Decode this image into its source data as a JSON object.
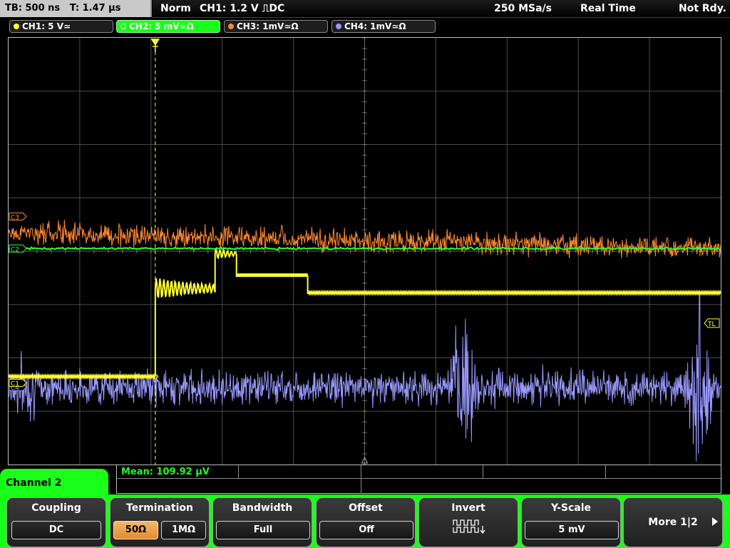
{
  "top": {
    "timebase": "TB: 500 ns",
    "trigger_time": "T: 1.47 µs",
    "mode": "Norm",
    "trigger_info": "CH1: 1.2 V ⎍DC",
    "sample_rate": "250 MSa/s",
    "acq_mode": "Real Time",
    "status": "Not Rdy."
  },
  "channels": [
    {
      "label": "CH1: 5 V≃",
      "color": "#ffff33",
      "active": false
    },
    {
      "label": "CH2: 5 mV≃Ω",
      "color": "#33ff33",
      "active": true
    },
    {
      "label": "CH3: 1mV≃Ω",
      "color": "#ff8833",
      "active": false
    },
    {
      "label": "CH4: 1mV≃Ω",
      "color": "#9999ff",
      "active": false
    }
  ],
  "markers": {
    "ch3": "C3",
    "ch2": "C2",
    "ch1": "C1",
    "ch4": "C4",
    "trigger_level": "TL"
  },
  "measurement": {
    "text": "Mean: 109.92 µV"
  },
  "menu": {
    "title": "Channel 2",
    "coupling": {
      "label": "Coupling",
      "value": "DC"
    },
    "termination": {
      "label": "Termination",
      "opt1": "50Ω",
      "opt2": "1MΩ",
      "selected": "50Ω"
    },
    "bandwidth": {
      "label": "Bandwidth",
      "value": "Full"
    },
    "offset": {
      "label": "Offset",
      "value": "Off"
    },
    "invert": {
      "label": "Invert",
      "icon": "invert-waveform-icon"
    },
    "yscale": {
      "label": "Y-Scale",
      "value": "5 mV"
    },
    "more": {
      "label": "More 1|2"
    }
  },
  "colors": {
    "ch1": "#ffff33",
    "ch2": "#33ff33",
    "ch3": "#ff8833",
    "ch4": "#9999ff",
    "grid": "#555555",
    "accent_green": "#1aff1a"
  },
  "traces": {
    "ch1": {
      "segments": [
        {
          "from_div": 0.0,
          "to_div": 2.06,
          "level_div": 1.65,
          "noise_div": 0.02,
          "ringing": false
        },
        {
          "from_div": 2.06,
          "to_div": 2.9,
          "level_div": 3.3,
          "noise_div": 0.1,
          "ringing": true
        },
        {
          "from_div": 2.9,
          "to_div": 3.2,
          "level_div": 3.95,
          "noise_div": 0.05,
          "ringing": true
        },
        {
          "from_div": 3.2,
          "to_div": 4.2,
          "level_div": 3.55,
          "noise_div": 0.03,
          "ringing": false
        },
        {
          "from_div": 4.2,
          "to_div": 10.0,
          "level_div": 3.22,
          "noise_div": 0.02,
          "ringing": false
        }
      ]
    },
    "ch2": {
      "level_div": 4.05,
      "noise_div": 0.03
    },
    "ch3": {
      "level_div": 4.35,
      "noise_div": 0.3,
      "trend_end_div": 4.05
    },
    "ch4": {
      "level_div": 1.45,
      "noise_div": 0.45,
      "bursts": [
        {
          "center_div": 6.4,
          "width_div": 0.6,
          "amp_div": 2.2
        },
        {
          "center_div": 9.7,
          "width_div": 0.5,
          "amp_div": 3.0
        }
      ]
    }
  }
}
